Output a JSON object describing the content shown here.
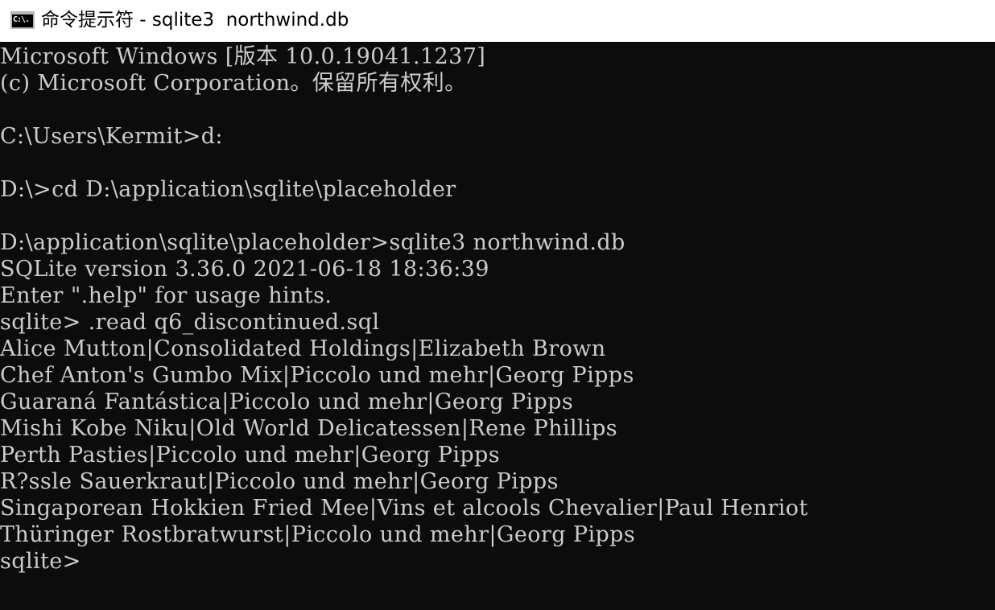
{
  "window": {
    "title": "命令提示符 - sqlite3  northwind.db",
    "icon": "cmd-icon",
    "icon_text": "C:\\.",
    "colors": {
      "titlebar_bg": "#ffffff",
      "console_bg": "#0c0c0c",
      "console_text": "#cccccc"
    }
  },
  "console": {
    "lines": [
      "Microsoft Windows [版本 10.0.19041.1237]",
      "(c) Microsoft Corporation。保留所有权利。",
      "",
      "C:\\Users\\Kermit>d:",
      "",
      "D:\\>cd D:\\application\\sqlite\\placeholder",
      "",
      "D:\\application\\sqlite\\placeholder>sqlite3 northwind.db",
      "SQLite version 3.36.0 2021-06-18 18:36:39",
      "Enter \".help\" for usage hints.",
      "sqlite> .read q6_discontinued.sql",
      "Alice Mutton|Consolidated Holdings|Elizabeth Brown",
      "Chef Anton's Gumbo Mix|Piccolo und mehr|Georg Pipps",
      "Guaraná Fantástica|Piccolo und mehr|Georg Pipps",
      "Mishi Kobe Niku|Old World Delicatessen|Rene Phillips",
      "Perth Pasties|Piccolo und mehr|Georg Pipps",
      "R?ssle Sauerkraut|Piccolo und mehr|Georg Pipps",
      "Singaporean Hokkien Fried Mee|Vins et alcools Chevalier|Paul Henriot",
      "Thüringer Rostbratwurst|Piccolo und mehr|Georg Pipps",
      "sqlite>"
    ]
  }
}
